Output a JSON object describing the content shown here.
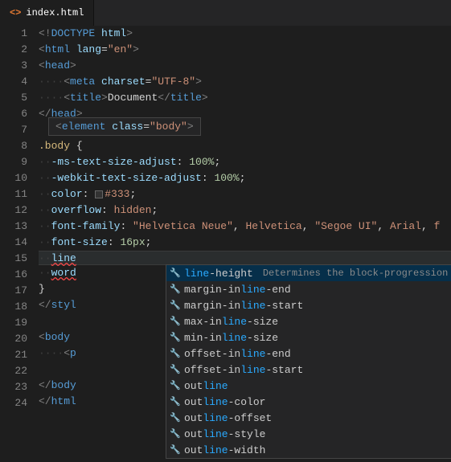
{
  "tab": {
    "icon": "<>",
    "label": "index.html"
  },
  "gutter": [
    "1",
    "2",
    "3",
    "4",
    "5",
    "6",
    "7",
    "8",
    "9",
    "10",
    "11",
    "12",
    "13",
    "14",
    "15",
    "16",
    "17",
    "18",
    "19",
    "20",
    "21",
    "22",
    "23",
    "24"
  ],
  "code": {
    "l1_doctype_open": "<!",
    "l1_doctype": "DOCTYPE",
    "l1_html": " html",
    "l1_close": ">",
    "l2_open": "<",
    "l2_tag": "html",
    "l2_attr": " lang",
    "l2_eq": "=",
    "l2_val": "\"en\"",
    "l2_close": ">",
    "l3_open": "<",
    "l3_tag": "head",
    "l3_close": ">",
    "l4_ws": "····",
    "l4_open": "<",
    "l4_tag": "meta",
    "l4_attr": " charset",
    "l4_eq": "=",
    "l4_val": "\"UTF-8\"",
    "l4_close": ">",
    "l5_ws": "····",
    "l5_open": "<",
    "l5_tag": "title",
    "l5_close1": ">",
    "l5_txt": "Document",
    "l5_open2": "</",
    "l5_tag2": "title",
    "l5_close2": ">",
    "l6_open": "</",
    "l6_tag": "head",
    "l6_close": ">",
    "l8_sel": ".body",
    "l8_brace": " {",
    "l9_ws": "··",
    "l9_prop": "-ms-text-size-adjust",
    "l9_colon": ": ",
    "l9_val": "100%",
    "l9_semi": ";",
    "l10_ws": "··",
    "l10_prop": "-webkit-text-size-adjust",
    "l10_colon": ": ",
    "l10_val": "100%",
    "l10_semi": ";",
    "l11_ws": "··",
    "l11_prop": "color",
    "l11_colon": ": ",
    "l11_val": "#333",
    "l11_semi": ";",
    "l12_ws": "··",
    "l12_prop": "overflow",
    "l12_colon": ": ",
    "l12_val": "hidden",
    "l12_semi": ";",
    "l13_ws": "··",
    "l13_prop": "font-family",
    "l13_colon": ": ",
    "l13_v1": "\"Helvetica Neue\"",
    "l13_c1": ", ",
    "l13_v2": "Helvetica",
    "l13_c2": ", ",
    "l13_v3": "\"Segoe UI\"",
    "l13_c3": ", ",
    "l13_v4": "Arial",
    "l13_c4": ", ",
    "l13_v5": "f",
    "l14_ws": "··",
    "l14_prop": "font-size",
    "l14_colon": ": ",
    "l14_val": "16px",
    "l14_semi": ";",
    "l15_ws": "··",
    "l15_txt": "line",
    "l16_ws": "··",
    "l16_txt": "word",
    "l17_brace": "}",
    "l18_open": "</",
    "l18_tag": "styl",
    "l20_open": "<",
    "l20_tag": "body",
    "l21_ws": "····",
    "l21_open": "<",
    "l21_tag": "p",
    "l23_open": "</",
    "l23_tag": "body",
    "l24_open": "</",
    "l24_tag": "html"
  },
  "hover": {
    "open": "<",
    "tag": "element",
    "attr": " class",
    "eq": "=",
    "val": "\"body\"",
    "close": ">"
  },
  "suggest": {
    "selected": {
      "pre": "",
      "hl": "line",
      "post": "-height",
      "doc": "Determines the block-progression dimension of the text cont…"
    },
    "items": [
      {
        "pre": "margin-in",
        "hl": "line",
        "post": "-end"
      },
      {
        "pre": "margin-in",
        "hl": "line",
        "post": "-start"
      },
      {
        "pre": "max-in",
        "hl": "line",
        "post": "-size"
      },
      {
        "pre": "min-in",
        "hl": "line",
        "post": "-size"
      },
      {
        "pre": "offset-in",
        "hl": "line",
        "post": "-end"
      },
      {
        "pre": "offset-in",
        "hl": "line",
        "post": "-start"
      },
      {
        "pre": "out",
        "hl": "line",
        "post": ""
      },
      {
        "pre": "out",
        "hl": "line",
        "post": "-color"
      },
      {
        "pre": "out",
        "hl": "line",
        "post": "-offset"
      },
      {
        "pre": "out",
        "hl": "line",
        "post": "-style"
      },
      {
        "pre": "out",
        "hl": "line",
        "post": "-width"
      }
    ]
  }
}
